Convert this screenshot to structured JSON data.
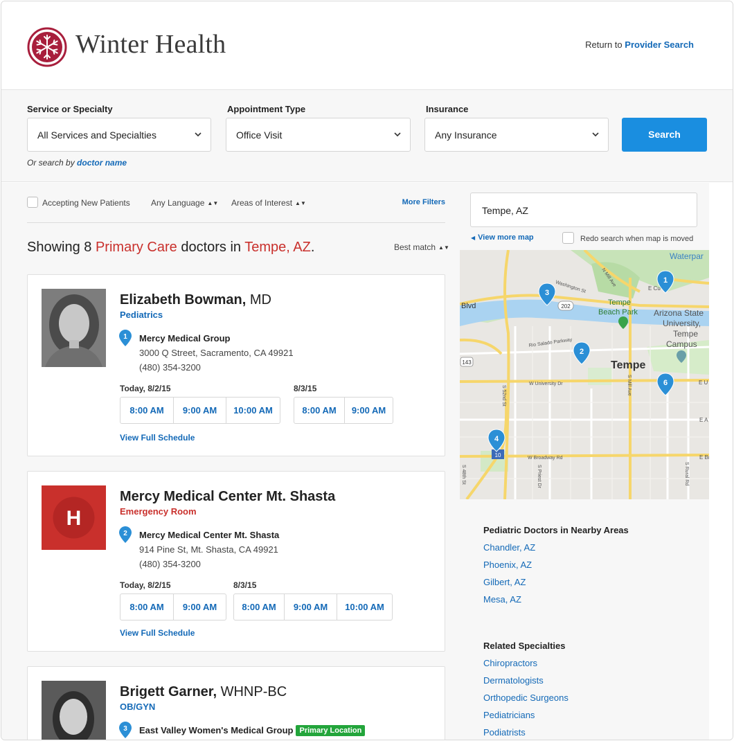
{
  "brand": {
    "name": "Winter Health"
  },
  "header": {
    "return_prefix": "Return to",
    "return_link": "Provider Search"
  },
  "search": {
    "service_label": "Service or Specialty",
    "service_value": "All Services and Specialties",
    "appointment_label": "Appointment Type",
    "appointment_value": "Office Visit",
    "insurance_label": "Insurance",
    "insurance_value": "Any Insurance",
    "search_button": "Search",
    "or_search_prefix": "Or search by",
    "or_search_link": "doctor name"
  },
  "filters": {
    "accepting": "Accepting New Patients",
    "language": "Any Language",
    "interest": "Areas of Interest",
    "more": "More Filters"
  },
  "results": {
    "prefix": "Showing 8",
    "specialty": "Primary Care",
    "middle": "doctors in",
    "location": "Tempe, AZ",
    "suffix": ".",
    "sort": "Best match"
  },
  "cards": [
    {
      "name": "Elizabeth Bowman,",
      "credential": "MD",
      "specialty": "Pediatrics",
      "specialty_color": "#1369b7",
      "pin": "1",
      "location": "Mercy Medical Group",
      "address": "3000 Q Street, Sacramento, CA 49921",
      "phone": "(480) 354-3200",
      "day1": "Today, 8/2/15",
      "day1_slots": [
        "8:00 AM",
        "9:00 AM",
        "10:00 AM"
      ],
      "day2": "8/3/15",
      "day2_slots": [
        "8:00 AM",
        "9:00 AM"
      ],
      "schedule": "View Full Schedule"
    },
    {
      "name": "Mercy Medical Center Mt. Shasta",
      "credential": "",
      "specialty": "Emergency Room",
      "specialty_color": "#c9302c",
      "pin": "2",
      "location": "Mercy Medical Center Mt. Shasta",
      "address": "914 Pine St, Mt. Shasta, CA 49921",
      "phone": "(480) 354-3200",
      "day1": "Today, 8/2/15",
      "day1_slots": [
        "8:00 AM",
        "9:00 AM"
      ],
      "day2": "8/3/15",
      "day2_slots": [
        "8:00 AM",
        "9:00 AM",
        "10:00 AM"
      ],
      "schedule": "View Full Schedule",
      "icon_letter": "H"
    },
    {
      "name": "Brigett Garner,",
      "credential": "WHNP-BC",
      "specialty": "OB/GYN",
      "specialty_color": "#1369b7",
      "pin": "3",
      "location": "East Valley Women's Medical Group",
      "badge": "Primary Location"
    }
  ],
  "map": {
    "location_input": "Tempe, AZ",
    "view_more": "View more map",
    "redo": "Redo search when map is moved",
    "labels": {
      "waterpark": "Waterpar",
      "washington": "Washington St",
      "mill_n": "N Mill Ave",
      "e_cu": "E Cu",
      "blvd": "Blvd",
      "hwy202": "202",
      "tempe_beach": "Tempe",
      "beach_park": "Beach Park",
      "asu1": "Arizona State",
      "asu2": "University,",
      "asu3": "Tempe",
      "asu4": "Campus",
      "rio_salado": "Rio Salado Parkway",
      "hwy143": "143",
      "tempe": "Tempe",
      "univ": "W University Dr",
      "s52": "S 52nd St",
      "mill_s": "S Mill Ave",
      "e_u": "E U",
      "e_a": "E A",
      "hwy10": "10",
      "broadway": "W Broadway Rd",
      "e_br": "E Br",
      "s48": "S 48th St",
      "priest": "S Priest Dr",
      "rural": "S Rural Rd"
    },
    "markers": [
      "1",
      "2",
      "3",
      "4",
      "6"
    ]
  },
  "sidebar": {
    "nearby_title": "Pediatric Doctors in Nearby Areas",
    "nearby": [
      "Chandler, AZ",
      "Phoenix, AZ",
      "Gilbert, AZ",
      "Mesa, AZ"
    ],
    "related_title": "Related Specialties",
    "related": [
      "Chiropractors",
      "Dermatologists",
      "Orthopedic Surgeons",
      "Pediatricians",
      "Podiatrists"
    ]
  },
  "colors": {
    "brand": "#a81e3c",
    "link": "#1369b7",
    "accent_red": "#c9302c",
    "search_button": "#1a8ee0",
    "primary_badge": "#23a53b"
  }
}
